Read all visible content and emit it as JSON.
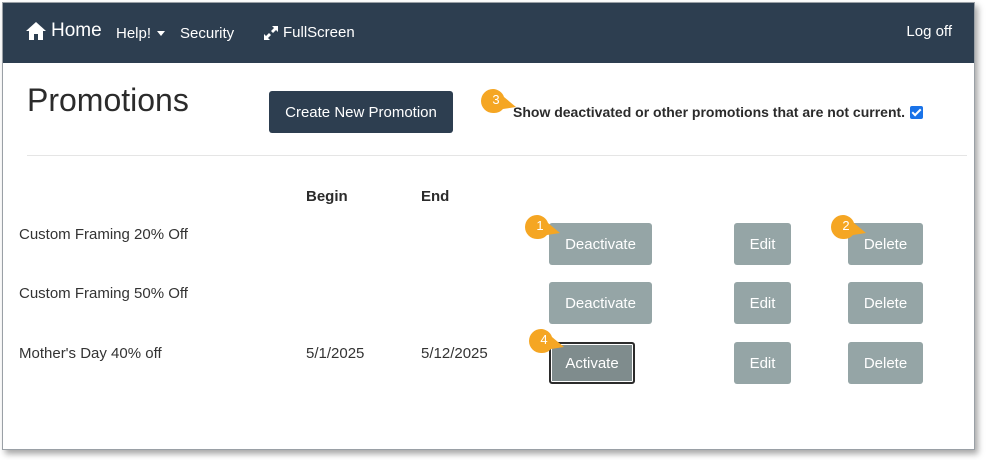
{
  "nav": {
    "home": "Home",
    "help": "Help!",
    "security": "Security",
    "fullscreen": "FullScreen",
    "logoff": "Log off"
  },
  "page": {
    "title": "Promotions",
    "create_button": "Create New Promotion",
    "show_deactivated_label": "Show deactivated or other promotions that are not current.",
    "show_deactivated_checked": true
  },
  "table": {
    "headers": {
      "begin": "Begin",
      "end": "End"
    },
    "rows": [
      {
        "name": "Custom Framing 20% Off",
        "begin": "",
        "end": "",
        "toggle": "Deactivate",
        "edit": "Edit",
        "delete": "Delete"
      },
      {
        "name": "Custom Framing 50% Off",
        "begin": "",
        "end": "",
        "toggle": "Deactivate",
        "edit": "Edit",
        "delete": "Delete"
      },
      {
        "name": "Mother's Day 40% off",
        "begin": "5/1/2025",
        "end": "5/12/2025",
        "toggle": "Activate",
        "edit": "Edit",
        "delete": "Delete"
      }
    ]
  },
  "callouts": [
    "1",
    "2",
    "3",
    "4"
  ],
  "colors": {
    "navbar": "#2d3e50",
    "button_gray": "#95a5a6",
    "callout": "#f5a623"
  }
}
